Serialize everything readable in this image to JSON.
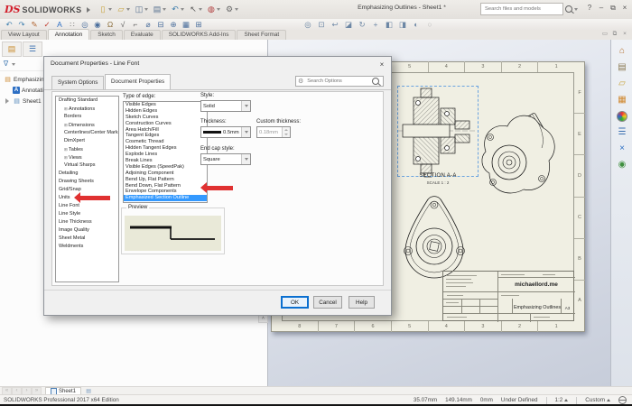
{
  "window": {
    "logo_mark": "DS",
    "brand": "SOLIDWORKS",
    "title": "Emphasizing Outlines - Sheet1 *",
    "search_placeholder": "Search files and models",
    "controls": [
      {
        "name": "help-icon",
        "glyph": "?"
      },
      {
        "name": "minimize-window-icon",
        "glyph": "–"
      },
      {
        "name": "restore-window-icon",
        "glyph": "⧉"
      },
      {
        "name": "close-window-icon",
        "glyph": "×"
      }
    ],
    "quick_access": [
      {
        "name": "new-document-icon",
        "glyph": "▯",
        "color": "#c7a23a"
      },
      {
        "name": "open-icon",
        "glyph": "▱",
        "color": "#c7a23a"
      },
      {
        "name": "save-icon",
        "glyph": "◫",
        "color": "#56708f"
      },
      {
        "name": "print-icon",
        "glyph": "▤",
        "color": "#56708f"
      },
      {
        "name": "undo-icon",
        "glyph": "↶",
        "color": "#3f7fae"
      },
      {
        "name": "select-icon",
        "glyph": "↖",
        "color": "#555555"
      },
      {
        "name": "rebuild-traffic-light-icon",
        "glyph": "◍",
        "color": "#b03a3a"
      },
      {
        "name": "options-gear-icon",
        "glyph": "⚙",
        "color": "#6a6a6a"
      }
    ]
  },
  "toolbar": {
    "annotation_icons": [
      {
        "name": "undo-icon",
        "glyph": "↶",
        "color": "#3f7fae"
      },
      {
        "name": "redo-icon",
        "glyph": "↷",
        "color": "#3f7fae"
      },
      {
        "name": "format-painter-icon",
        "glyph": "✎",
        "color": "#b0622e"
      },
      {
        "name": "spell-checker-icon",
        "glyph": "✓",
        "color": "#c0392b"
      },
      {
        "name": "note-icon",
        "glyph": "A",
        "color": "#2d6fc4"
      },
      {
        "name": "linear-note-pattern-icon",
        "glyph": "∷",
        "color": "#777777"
      },
      {
        "name": "zoom-icon",
        "glyph": "◎",
        "color": "#4a6e9c"
      },
      {
        "name": "magnifier-icon",
        "glyph": "◉",
        "color": "#4a6e9c"
      },
      {
        "name": "balloon-icon",
        "glyph": "Ω",
        "color": "#8a6d3b"
      },
      {
        "name": "surface-finish-icon",
        "glyph": "√",
        "color": "#555555"
      },
      {
        "name": "weld-symbol-icon",
        "glyph": "⌐",
        "color": "#555555"
      },
      {
        "name": "hole-callout-icon",
        "glyph": "⌀",
        "color": "#4a6e9c"
      },
      {
        "name": "datum-feature-icon",
        "glyph": "⊟",
        "color": "#4a6e9c"
      },
      {
        "name": "center-mark-icon",
        "glyph": "⊕",
        "color": "#4a6e9c"
      },
      {
        "name": "area-hatch-icon",
        "glyph": "▦",
        "color": "#4a6e9c"
      },
      {
        "name": "tables-icon",
        "glyph": "⊞",
        "color": "#4a6e9c"
      }
    ],
    "view_icons": [
      {
        "name": "zoom-to-fit-icon",
        "glyph": "◎"
      },
      {
        "name": "zoom-to-area-icon",
        "glyph": "⊡"
      },
      {
        "name": "previous-view-icon",
        "glyph": "↩"
      },
      {
        "name": "section-view-icon",
        "glyph": "◪"
      },
      {
        "name": "rotate-view-icon",
        "glyph": "↻"
      },
      {
        "name": "pan-icon",
        "glyph": "+"
      },
      {
        "name": "3d-drawing-view-icon",
        "glyph": "◧"
      },
      {
        "name": "view-orientation-icon",
        "glyph": "◨"
      },
      {
        "name": "display-style-icon",
        "glyph": "◐"
      },
      {
        "name": "hide-show-icon",
        "glyph": "○",
        "color": "#b9b9b9"
      }
    ]
  },
  "ribbon_tabs": [
    {
      "label": "View Layout"
    },
    {
      "label": "Annotation",
      "active": true
    },
    {
      "label": "Sketch"
    },
    {
      "label": "Evaluate"
    },
    {
      "label": "SOLIDWORKS Add-Ins"
    },
    {
      "label": "Sheet Format"
    }
  ],
  "doc_controls": [
    {
      "name": "minimize-doc-icon",
      "glyph": "▭"
    },
    {
      "name": "restore-doc-icon",
      "glyph": "⧉"
    },
    {
      "name": "close-doc-icon",
      "glyph": "×"
    }
  ],
  "feature_panel": {
    "tab_icons": [
      {
        "name": "featuremanager-tab-icon",
        "glyph": "▤",
        "color": "#c98c2e"
      },
      {
        "name": "propertymanager-tab-icon",
        "glyph": "☰",
        "color": "#3a6fb0"
      }
    ],
    "root": "Emphasizing Outlines",
    "annotations": "Annotations",
    "sheet": "Sheet1",
    "scroll_up_glyph": "˄"
  },
  "dialog": {
    "title": "Document Properties - Line Font",
    "close_glyph": "×",
    "tabs": [
      {
        "label": "System Options"
      },
      {
        "label": "Document Properties",
        "active": true
      }
    ],
    "search_placeholder": "Search Options",
    "tree_items": [
      {
        "label": "Drafting Standard"
      },
      {
        "label": "Annotations",
        "indent": true,
        "expand": true
      },
      {
        "label": "Borders",
        "indent": true
      },
      {
        "label": "Dimensions",
        "indent": true,
        "expand": true
      },
      {
        "label": "Centerlines/Center Marks",
        "indent": true
      },
      {
        "label": "DimXpert",
        "indent": true
      },
      {
        "label": "Tables",
        "indent": true,
        "expand": true
      },
      {
        "label": "Views",
        "indent": true,
        "expand": true
      },
      {
        "label": "Virtual Sharps",
        "indent": true
      },
      {
        "label": "Detailing"
      },
      {
        "label": "Drawing Sheets"
      },
      {
        "label": "Grid/Snap"
      },
      {
        "label": "Units"
      },
      {
        "label": "Line Font"
      },
      {
        "label": "Line Style"
      },
      {
        "label": "Line Thickness"
      },
      {
        "label": "Image Quality"
      },
      {
        "label": "Sheet Metal"
      },
      {
        "label": "Weldments"
      }
    ],
    "edge_list_label": "Type of edge:",
    "edge_list": [
      {
        "label": "Visible Edges"
      },
      {
        "label": "Hidden Edges"
      },
      {
        "label": "Sketch Curves"
      },
      {
        "label": "Construction Curves"
      },
      {
        "label": "Area Hatch/Fill"
      },
      {
        "label": "Tangent Edges"
      },
      {
        "label": "Cosmetic Thread"
      },
      {
        "label": "Hidden Tangent Edges"
      },
      {
        "label": "Explode Lines"
      },
      {
        "label": "Break Lines"
      },
      {
        "label": "Visible Edges (SpeedPak)"
      },
      {
        "label": "Adjoining Component"
      },
      {
        "label": "Bend Up, Flat Pattern"
      },
      {
        "label": "Bend Down, Flat Pattern"
      },
      {
        "label": "Envelope Components"
      },
      {
        "label": "Emphasized Section Outline",
        "selected": true
      }
    ],
    "fields": {
      "style_label": "Style:",
      "style_value": "Solid",
      "thickness_label": "Thickness:",
      "thickness_value": "0.5mm",
      "custom_thickness_label": "Custom thickness:",
      "custom_thickness_value": "0.18mm",
      "end_cap_label": "End cap style:",
      "end_cap_value": "Square"
    },
    "preview_label": "Preview",
    "buttons": {
      "ok": "OK",
      "cancel": "Cancel",
      "help": "Help"
    }
  },
  "sheet": {
    "zones_x": [
      "8",
      "7",
      "6",
      "5",
      "4",
      "3",
      "2",
      "1"
    ],
    "zones_y": [
      "F",
      "E",
      "D",
      "C",
      "B",
      "A"
    ],
    "section_label": "SECTION A-A",
    "scale_label": "SCALE 1 : 2",
    "title_block": {
      "website": "michaellord.me",
      "drawing_title": "Emphasizing Outlines",
      "size": "A3"
    }
  },
  "sheet_tabs": {
    "active": "Sheet1",
    "nav": [
      "«",
      "‹",
      "›",
      "»"
    ]
  },
  "status_bar": {
    "left": "SOLIDWORKS Professional 2017 x64 Edition",
    "x": "35.07mm",
    "y": "149.14mm",
    "z": "0mm",
    "state": "Under Defined",
    "scale": "1:2",
    "units": "Custom"
  },
  "task_pane_icons": [
    {
      "name": "home-icon",
      "glyph": "⌂",
      "color": "#b5702e"
    },
    {
      "name": "design-library-icon",
      "glyph": "▤",
      "color": "#8a7a52"
    },
    {
      "name": "file-explorer-icon",
      "glyph": "▱",
      "color": "#c7a23a"
    },
    {
      "name": "view-palette-icon",
      "glyph": "▦",
      "color": "#d0882f"
    },
    {
      "name": "appearances-icon",
      "glyph": "",
      "color": ""
    },
    {
      "name": "custom-properties-icon",
      "glyph": "☰",
      "color": "#3a6fb0"
    },
    {
      "name": "xpress-products-icon",
      "glyph": "×",
      "color": "#2d6fc4"
    },
    {
      "name": "resources-icon",
      "glyph": "◉",
      "color": "#3f8f3f"
    }
  ],
  "colors": {
    "selection": "#3399ff",
    "arrow": "#e03131",
    "paper": "#f0efe3",
    "preview_bg": "#e9e9d8"
  }
}
